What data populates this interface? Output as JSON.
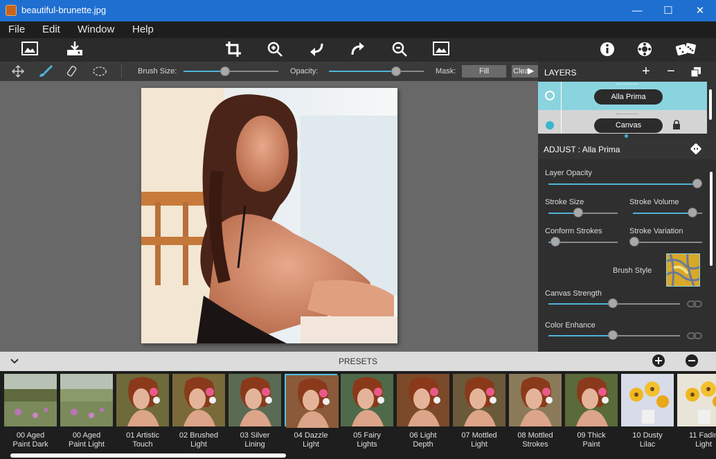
{
  "window": {
    "title": "beautiful-brunette.jpg",
    "minimize": "—",
    "maximize": "☐",
    "close": "✕"
  },
  "menu": {
    "file": "File",
    "edit": "Edit",
    "window": "Window",
    "help": "Help"
  },
  "tool_options": {
    "brush_size_label": "Brush Size:",
    "opacity_label": "Opacity:",
    "mask_label": "Mask:",
    "fill_button": "Fill",
    "clear_button": "Clear",
    "brush_size_value": 0.44,
    "opacity_value": 0.71
  },
  "layers": {
    "header": "LAYERS",
    "add": "+",
    "remove": "−",
    "items": [
      {
        "name": "Alla Prima",
        "selected": true
      },
      {
        "name": "Canvas",
        "locked": true
      }
    ]
  },
  "adjust": {
    "header": "ADJUST : Alla Prima",
    "layer_opacity": {
      "label": "Layer Opacity",
      "value": 1.0
    },
    "stroke_size": {
      "label": "Stroke Size",
      "value": 0.43
    },
    "stroke_volume": {
      "label": "Stroke Volume",
      "value": 0.86
    },
    "conform_strokes": {
      "label": "Conform Strokes",
      "value": 0.1
    },
    "stroke_variation": {
      "label": "Stroke Variation",
      "value": 0.02
    },
    "brush_style": {
      "label": "Brush Style"
    },
    "canvas_strength": {
      "label": "Canvas Strength",
      "value": 0.49
    },
    "color_enhance": {
      "label": "Color Enhance",
      "value": 0.49
    }
  },
  "presets": {
    "header": "PRESETS",
    "items": [
      {
        "line1": "00 Aged",
        "line2": "Paint Dark",
        "kind": "landscape",
        "tint": "#5f6a3e"
      },
      {
        "line1": "00 Aged",
        "line2": "Paint Light",
        "kind": "landscape",
        "tint": "#8a9a6a"
      },
      {
        "line1": "01 Artistic",
        "line2": "Touch",
        "kind": "portrait",
        "tint": "#6e6a3a"
      },
      {
        "line1": "02 Brushed",
        "line2": "Light",
        "kind": "portrait",
        "tint": "#7a6a3a"
      },
      {
        "line1": "03 Silver",
        "line2": "Lining",
        "kind": "portrait",
        "tint": "#5b6a52"
      },
      {
        "line1": "04 Dazzle",
        "line2": "Light",
        "kind": "portrait",
        "tint": "#8a5a3a",
        "selected": true
      },
      {
        "line1": "05 Fairy",
        "line2": "Lights",
        "kind": "portrait",
        "tint": "#4f6a4a"
      },
      {
        "line1": "06 Light",
        "line2": "Depth",
        "kind": "portrait",
        "tint": "#7a4a2a"
      },
      {
        "line1": "07 Mottled",
        "line2": "Light",
        "kind": "portrait",
        "tint": "#6a5a3a"
      },
      {
        "line1": "08 Mottled",
        "line2": "Strokes",
        "kind": "portrait",
        "tint": "#8a7a5a"
      },
      {
        "line1": "09 Thick",
        "line2": "Paint",
        "kind": "portrait",
        "tint": "#5a6a3a"
      },
      {
        "line1": "10 Dusty",
        "line2": "Lilac",
        "kind": "flowers",
        "tint": "#d8dce8"
      },
      {
        "line1": "11 Fadin",
        "line2": "Light",
        "kind": "flowers",
        "tint": "#e8e4d8"
      }
    ]
  }
}
